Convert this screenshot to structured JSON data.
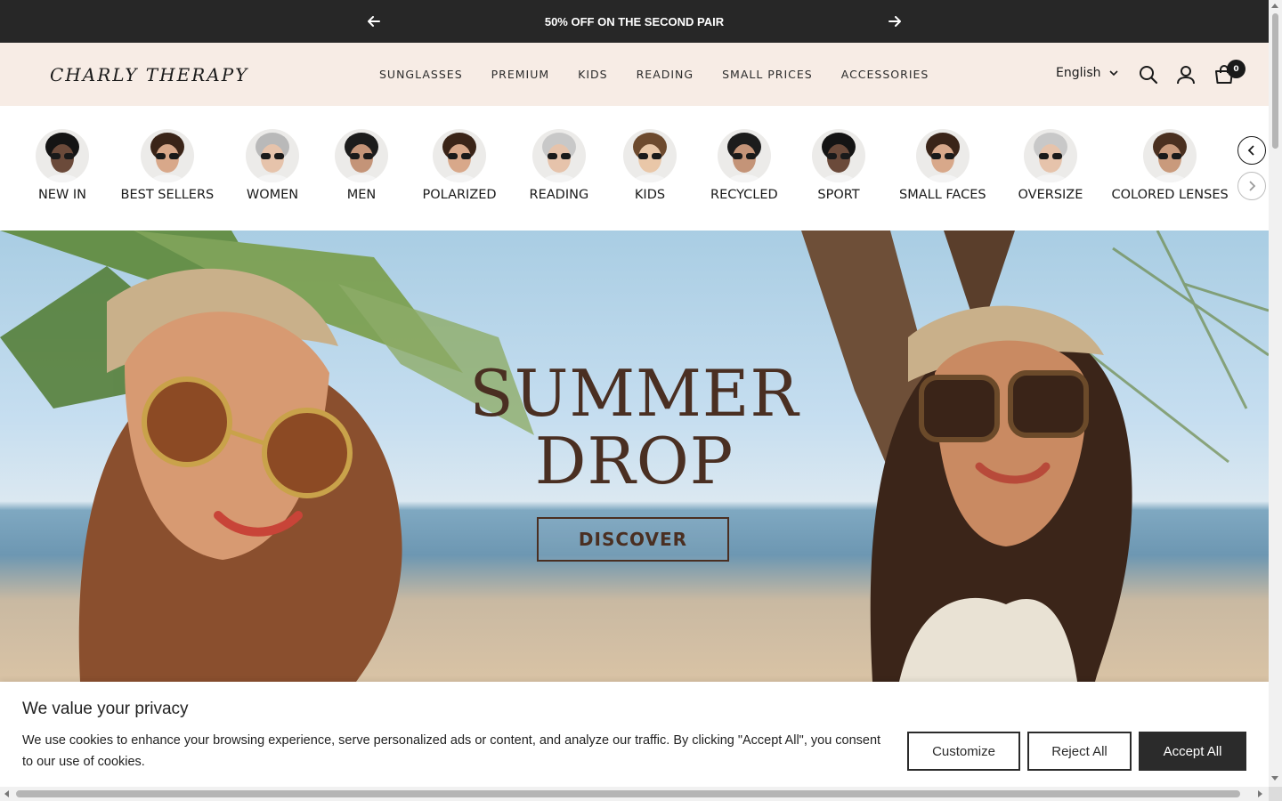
{
  "announcement": {
    "message": "50% OFF ON THE SECOND PAIR",
    "prev_icon": "arrow-left-icon",
    "next_icon": "arrow-right-icon"
  },
  "header": {
    "logo": "CHARLY THERAPY",
    "nav": [
      "SUNGLASSES",
      "PREMIUM",
      "KIDS",
      "READING",
      "SMALL PRICES",
      "ACCESSORIES"
    ],
    "language": "English",
    "cart_count": "0",
    "background": "#f7ece5"
  },
  "categories": [
    {
      "label": "NEW IN",
      "skin": "#6b4a3a",
      "hair": "#141414"
    },
    {
      "label": "BEST SELLERS",
      "skin": "#d8a88a",
      "hair": "#3a2418"
    },
    {
      "label": "WOMEN",
      "skin": "#e6c3ab",
      "hair": "#b9b9b9"
    },
    {
      "label": "MEN",
      "skin": "#c49478",
      "hair": "#1c1c1c"
    },
    {
      "label": "POLARIZED",
      "skin": "#d8a88a",
      "hair": "#3a2418"
    },
    {
      "label": "READING",
      "skin": "#e6c3ab",
      "hair": "#c8c8c8"
    },
    {
      "label": "KIDS",
      "skin": "#e9c7a8",
      "hair": "#6d4a2e"
    },
    {
      "label": "RECYCLED",
      "skin": "#c49478",
      "hair": "#1c1c1c"
    },
    {
      "label": "SPORT",
      "skin": "#6b4a3a",
      "hair": "#141414"
    },
    {
      "label": "SMALL FACES",
      "skin": "#d8a88a",
      "hair": "#3a2418"
    },
    {
      "label": "OVERSIZE",
      "skin": "#e6c3ab",
      "hair": "#c8c8c8"
    },
    {
      "label": "COLORED LENSES",
      "skin": "#c99a7c",
      "hair": "#4a3020"
    }
  ],
  "hero": {
    "title_line1": "SUMMER",
    "title_line2": "DROP",
    "cta": "DISCOVER",
    "text_color": "#4a2f22"
  },
  "cookie": {
    "title": "We value your privacy",
    "text": "We use cookies to enhance your browsing experience, serve personalized ads or content, and analyze our traffic. By clicking \"Accept All\", you consent to our use of cookies.",
    "customize": "Customize",
    "reject": "Reject All",
    "accept": "Accept All"
  }
}
